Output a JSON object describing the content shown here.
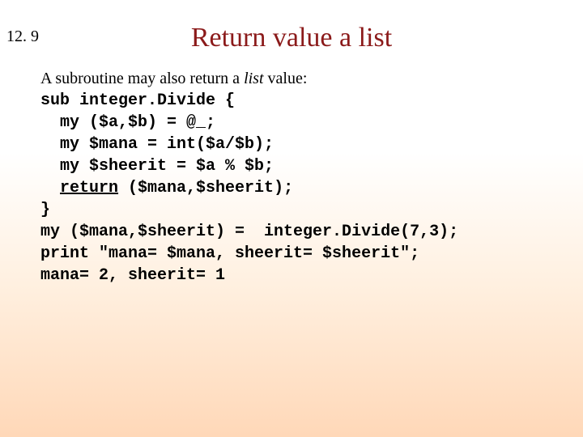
{
  "slide": {
    "number": "12. 9",
    "title": "Return value a list"
  },
  "intro": {
    "pre": "A subroutine may also return a ",
    "ital": "list",
    "post": " value:"
  },
  "code": {
    "l1": "sub integer.Divide {",
    "l2": "  my ($a,$b) = @_;",
    "l3": "  my $mana = int($a/$b);",
    "l4": "  my $sheerit = $a % $b;",
    "l5a": "  ",
    "l5_return": "return",
    "l5b": " ($mana,$sheerit);",
    "l6": "}",
    "l7": "my ($mana,$sheerit) =  integer.Divide(7,3);",
    "l8": "print \"mana= $mana, sheerit= $sheerit\";",
    "l9": "mana= 2, sheerit= 1"
  }
}
